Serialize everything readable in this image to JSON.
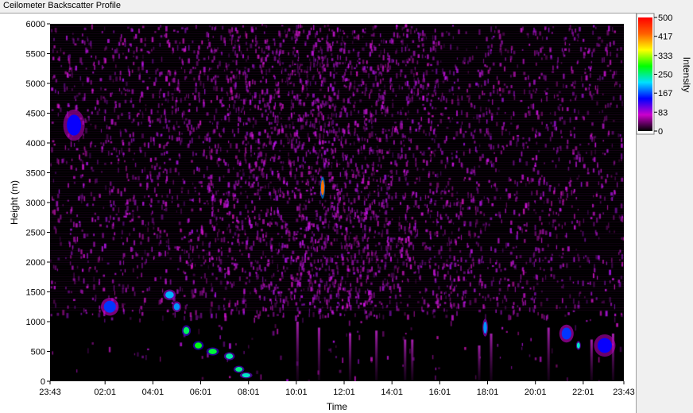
{
  "window": {
    "title": "Ceilometer Backscatter Profile"
  },
  "colors": {
    "plot_background": "#000000",
    "noise_color": "#d030e0",
    "frame_background": "#ffffff",
    "app_background": "#f0f0f0"
  },
  "chart_data": {
    "type": "heatmap",
    "title": "Ceilometer Backscatter Profile",
    "xlabel": "Time",
    "ylabel": "Height (m)",
    "x_ticks": [
      "23:43",
      "02:01",
      "04:01",
      "06:01",
      "08:01",
      "10:01",
      "12:01",
      "14:01",
      "16:01",
      "18:01",
      "20:01",
      "22:01",
      "23:43"
    ],
    "x_tick_hours": [
      0,
      2.3,
      4.3,
      6.3,
      8.3,
      10.3,
      12.3,
      14.3,
      16.3,
      18.3,
      20.3,
      22.3,
      24
    ],
    "xlim_hours": [
      0,
      24
    ],
    "y_ticks": [
      0,
      500,
      1000,
      1500,
      2000,
      2500,
      3000,
      3500,
      4000,
      4500,
      5000,
      5500,
      6000
    ],
    "ylim": [
      0,
      6000
    ],
    "colorbar": {
      "label": "Intensity",
      "ticks": [
        500,
        417,
        333,
        250,
        167,
        83,
        0
      ],
      "range": [
        0,
        500
      ],
      "colormap": [
        "#000000",
        "#cc00cc",
        "#0000ff",
        "#00e0ff",
        "#00ff00",
        "#ffff00",
        "#ff6000",
        "#ff0000"
      ]
    },
    "features": [
      {
        "t": 1.0,
        "h": 4300,
        "dt": 0.6,
        "dh": 350,
        "v": 140
      },
      {
        "t": 2.5,
        "h": 1250,
        "dt": 0.5,
        "dh": 200,
        "v": 160
      },
      {
        "t": 5.0,
        "h": 1450,
        "dt": 0.35,
        "dh": 120,
        "v": 200
      },
      {
        "t": 5.3,
        "h": 1250,
        "dt": 0.25,
        "dh": 120,
        "v": 190
      },
      {
        "t": 5.7,
        "h": 850,
        "dt": 0.25,
        "dh": 120,
        "v": 260
      },
      {
        "t": 6.2,
        "h": 600,
        "dt": 0.3,
        "dh": 100,
        "v": 280
      },
      {
        "t": 6.8,
        "h": 500,
        "dt": 0.35,
        "dh": 90,
        "v": 270
      },
      {
        "t": 7.5,
        "h": 420,
        "dt": 0.3,
        "dh": 90,
        "v": 240
      },
      {
        "t": 7.9,
        "h": 200,
        "dt": 0.3,
        "dh": 80,
        "v": 250
      },
      {
        "t": 8.2,
        "h": 100,
        "dt": 0.35,
        "dh": 70,
        "v": 230
      },
      {
        "t": 11.4,
        "h": 3250,
        "dt": 0.12,
        "dh": 250,
        "v": 420
      },
      {
        "t": 18.2,
        "h": 900,
        "dt": 0.15,
        "dh": 200,
        "v": 190
      },
      {
        "t": 21.6,
        "h": 800,
        "dt": 0.4,
        "dh": 200,
        "v": 160
      },
      {
        "t": 22.1,
        "h": 600,
        "dt": 0.12,
        "dh": 100,
        "v": 230
      },
      {
        "t": 23.2,
        "h": 600,
        "dt": 0.6,
        "dh": 250,
        "v": 140
      }
    ]
  }
}
